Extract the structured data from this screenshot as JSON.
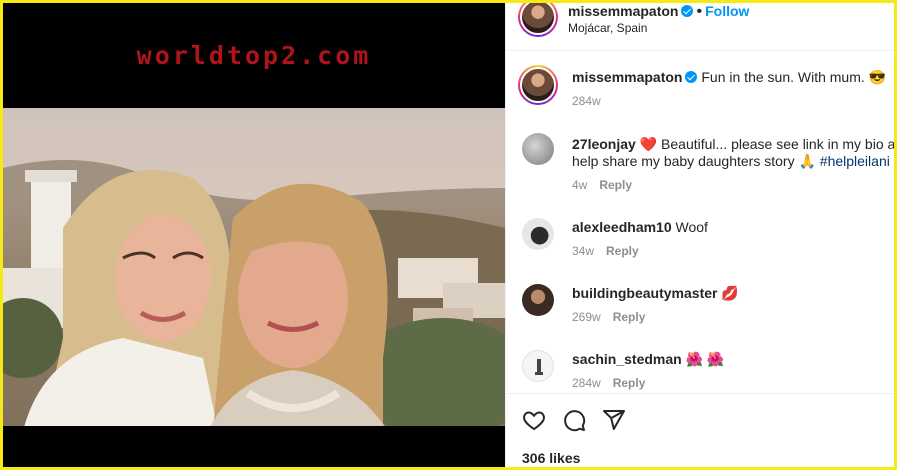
{
  "media": {
    "watermark": "worldtop2.com"
  },
  "post": {
    "author": "missemmapaton",
    "follow_label": "Follow",
    "location": "Mojácar, Spain",
    "caption": "Fun in the sun. With mum. 😎",
    "caption_age": "284w",
    "likes": "306 likes"
  },
  "comments": [
    {
      "user": "27leonjay",
      "text": "❤️ Beautiful... please see link in my bio an",
      "text2": "help share my baby daughters story 🙏",
      "hashtag": "#helpleilani",
      "age": "4w",
      "reply": "Reply"
    },
    {
      "user": "alexleedham10",
      "text": "Woof",
      "age": "34w",
      "reply": "Reply"
    },
    {
      "user": "buildingbeautymaster",
      "text": "💋",
      "age": "269w",
      "reply": "Reply"
    },
    {
      "user": "sachin_stedman",
      "text": "🌺 🌺",
      "age": "284w",
      "reply": "Reply"
    }
  ],
  "icons": [
    "heart-icon",
    "comment-icon",
    "share-icon",
    "verified-badge-icon"
  ],
  "colors": {
    "accent": "#0095f6",
    "frame": "#f5ea15",
    "watermark": "#b0141b"
  }
}
